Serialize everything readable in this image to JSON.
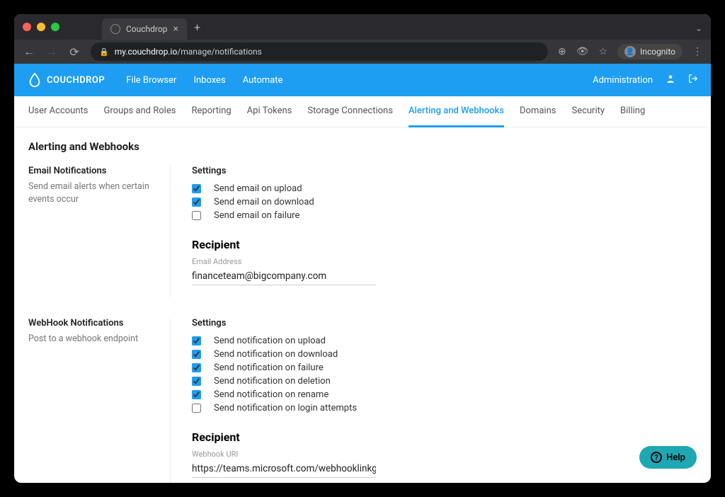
{
  "browser": {
    "tab_title": "Couchdrop",
    "url_domain": "my.couchdrop.io",
    "url_path": "/manage/notifications",
    "incognito_label": "Incognito"
  },
  "header": {
    "brand": "COUCHDROP",
    "nav": [
      "File Browser",
      "Inboxes",
      "Automate"
    ],
    "admin_label": "Administration"
  },
  "subnav": {
    "items": [
      "User Accounts",
      "Groups and Roles",
      "Reporting",
      "Api Tokens",
      "Storage Connections",
      "Alerting and Webhooks",
      "Domains",
      "Security",
      "Billing"
    ],
    "active_index": 5
  },
  "page": {
    "title": "Alerting and Webhooks"
  },
  "email_section": {
    "heading": "Email Notifications",
    "description": "Send email alerts when certain events occur",
    "settings_label": "Settings",
    "options": [
      {
        "label": "Send email on upload",
        "checked": true
      },
      {
        "label": "Send email on download",
        "checked": true
      },
      {
        "label": "Send email on failure",
        "checked": false
      }
    ],
    "recipient_label": "Recipient",
    "field_label": "Email Address",
    "field_value": "financeteam@bigcompany.com"
  },
  "webhook_section": {
    "heading": "WebHook Notifications",
    "description": "Post to a webhook endpoint",
    "settings_label": "Settings",
    "options": [
      {
        "label": "Send notification on upload",
        "checked": true
      },
      {
        "label": "Send notification on download",
        "checked": true
      },
      {
        "label": "Send notification on failure",
        "checked": true
      },
      {
        "label": "Send notification on deletion",
        "checked": true
      },
      {
        "label": "Send notification on rename",
        "checked": true
      },
      {
        "label": "Send notification on login attempts",
        "checked": false
      }
    ],
    "recipient_label": "Recipient",
    "field_label": "Webhook URI",
    "field_value": "https://teams.microsoft.com/webhooklinkgoeshe"
  },
  "help_label": "Help"
}
